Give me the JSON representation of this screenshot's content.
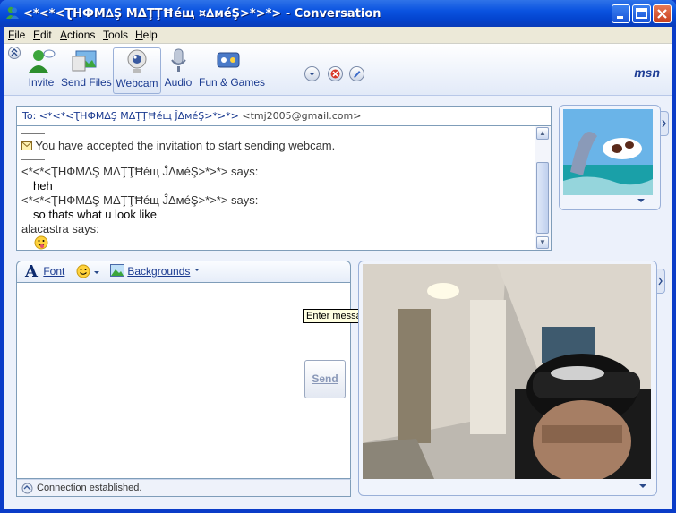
{
  "window": {
    "title": "<*<*<ƮНФМ∆Ş МΔŢŢĦéщ ¤∆мéŞ>*>*> - Conversation",
    "buttons": [
      "minimize",
      "maximize",
      "close"
    ]
  },
  "menu": [
    "File",
    "Edit",
    "Actions",
    "Tools",
    "Help"
  ],
  "toolbar": {
    "items": [
      {
        "label": "Invite",
        "icon": "invite-icon"
      },
      {
        "label": "Send Files",
        "icon": "send-files-icon"
      },
      {
        "label": "Webcam",
        "icon": "webcam-icon",
        "active": true
      },
      {
        "label": "Audio",
        "icon": "audio-icon"
      },
      {
        "label": "Fun & Games",
        "icon": "fun-games-icon"
      }
    ],
    "round_buttons": [
      "dropdown-icon",
      "block-icon",
      "pen-icon"
    ],
    "logo": "msn"
  },
  "to_line": {
    "prefix": "To:",
    "name": "<*<*<ƮНФМ∆Ş МΔŢŢĦéщ ĴΔмéŞ>*>*>",
    "email": "<tmj2005@gmail.com>"
  },
  "history": {
    "separator": "——",
    "notice": "You have accepted the invitation to start sending webcam.",
    "messages": [
      {
        "sender": "<*<*<ƮНФМ∆Ş МΔŢŢĦéщ ĴΔмéŞ>*>*> says:",
        "text": "heh"
      },
      {
        "sender": "<*<*<ƮНФМ∆Ş МΔŢŢĦéщ ĴΔмéŞ>*>*> says:",
        "text": "so thats what u look like"
      },
      {
        "sender": "alacastra says:",
        "text": ""
      }
    ]
  },
  "compose": {
    "font_label": "Font",
    "backgrounds_label": "Backgrounds",
    "send_label": "Send",
    "tooltip": "Enter message here",
    "status": "Connection established."
  },
  "colors": {
    "title_bar": "#0a53e0",
    "frame": "#0a3cc8",
    "client_bg": "#ecf1fb",
    "border": "#7f9db9"
  }
}
